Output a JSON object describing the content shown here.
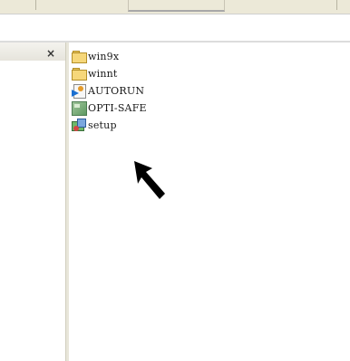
{
  "left_pane": {
    "close_glyph": "×"
  },
  "files": [
    {
      "label": "win9x",
      "icon": "folder-icon"
    },
    {
      "label": "winnt",
      "icon": "folder-icon"
    },
    {
      "label": "AUTORUN",
      "icon": "autorun-icon"
    },
    {
      "label": "OPTI-SAFE",
      "icon": "optisafe-icon"
    },
    {
      "label": "setup",
      "icon": "setup-icon"
    }
  ],
  "colors": {
    "folder": "#f6d77a",
    "pointer": "#000000"
  }
}
